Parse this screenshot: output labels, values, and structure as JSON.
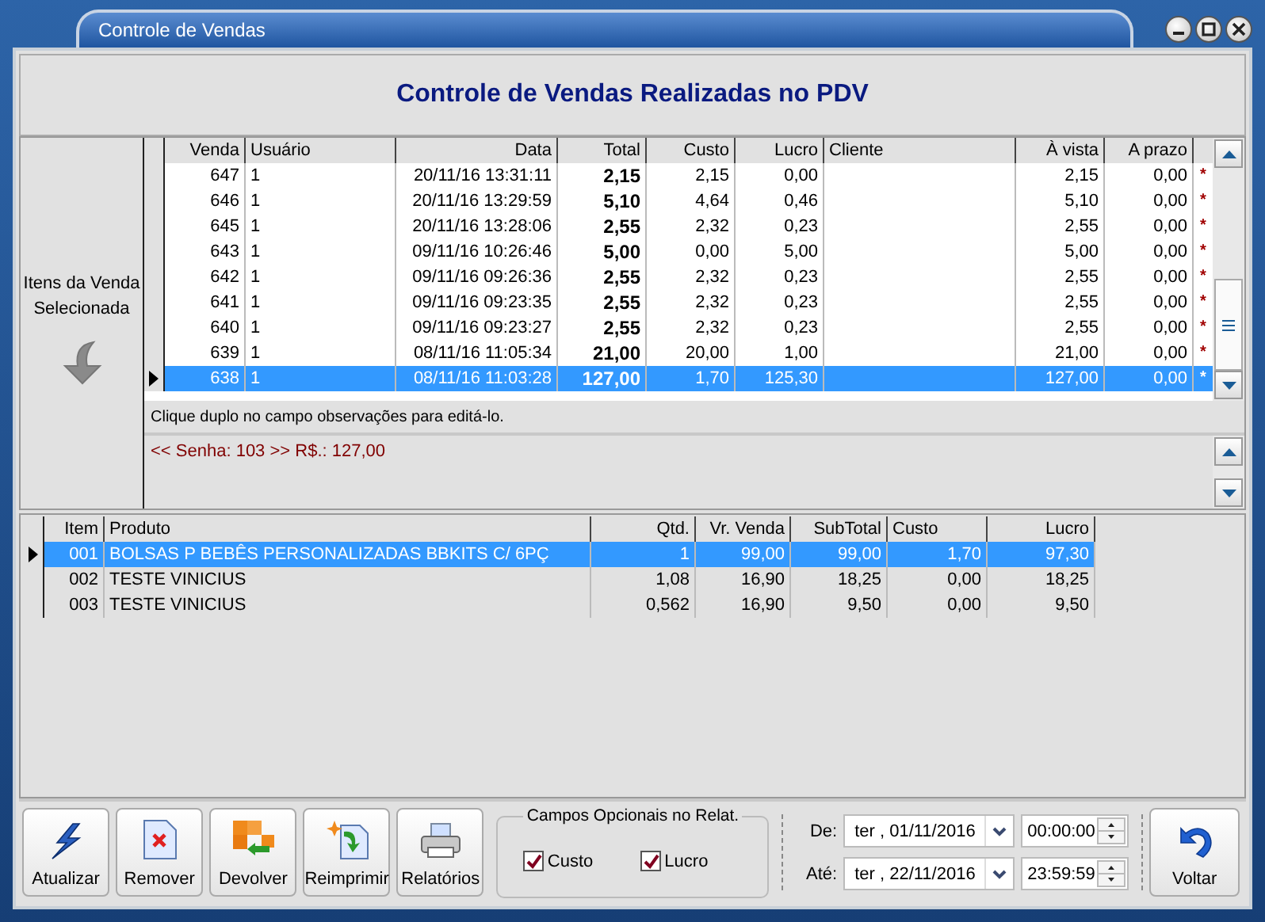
{
  "window": {
    "title": "Controle de Vendas",
    "controls": [
      {
        "kind": "minimize"
      },
      {
        "kind": "maximize"
      },
      {
        "kind": "close"
      }
    ]
  },
  "header": {
    "title": "Controle de Vendas Realizadas no PDV"
  },
  "side_panel": {
    "label": "Itens da Venda Selecionada"
  },
  "sales_table": {
    "columns": [
      "Venda",
      "Usuário",
      "Data",
      "Total",
      "Custo",
      "Lucro",
      "Cliente",
      "À vista",
      "A prazo"
    ],
    "rows": [
      {
        "cells": [
          "647",
          "1",
          "20/11/16 13:31:11",
          "2,15",
          "2,15",
          "0,00",
          "",
          "2,15",
          "0,00"
        ],
        "mark": "*",
        "selected": false
      },
      {
        "cells": [
          "646",
          "1",
          "20/11/16 13:29:59",
          "5,10",
          "4,64",
          "0,46",
          "",
          "5,10",
          "0,00"
        ],
        "mark": "*",
        "selected": false
      },
      {
        "cells": [
          "645",
          "1",
          "20/11/16 13:28:06",
          "2,55",
          "2,32",
          "0,23",
          "",
          "2,55",
          "0,00"
        ],
        "mark": "*",
        "selected": false
      },
      {
        "cells": [
          "643",
          "1",
          "09/11/16 10:26:46",
          "5,00",
          "0,00",
          "5,00",
          "",
          "5,00",
          "0,00"
        ],
        "mark": "*",
        "selected": false
      },
      {
        "cells": [
          "642",
          "1",
          "09/11/16 09:26:36",
          "2,55",
          "2,32",
          "0,23",
          "",
          "2,55",
          "0,00"
        ],
        "mark": "*",
        "selected": false
      },
      {
        "cells": [
          "641",
          "1",
          "09/11/16 09:23:35",
          "2,55",
          "2,32",
          "0,23",
          "",
          "2,55",
          "0,00"
        ],
        "mark": "*",
        "selected": false
      },
      {
        "cells": [
          "640",
          "1",
          "09/11/16 09:23:27",
          "2,55",
          "2,32",
          "0,23",
          "",
          "2,55",
          "0,00"
        ],
        "mark": "*",
        "selected": false
      },
      {
        "cells": [
          "639",
          "1",
          "08/11/16 11:05:34",
          "21,00",
          "20,00",
          "1,00",
          "",
          "21,00",
          "0,00"
        ],
        "mark": "*",
        "selected": false
      },
      {
        "cells": [
          "638",
          "1",
          "08/11/16 11:03:28",
          "127,00",
          "1,70",
          "125,30",
          "",
          "127,00",
          "0,00"
        ],
        "mark": "*",
        "selected": true
      }
    ],
    "hint": "Clique duplo no campo observações para editá-lo.",
    "note": "<< Senha: 103 >> R$.: 127,00"
  },
  "items_table": {
    "columns": [
      "Item",
      "Produto",
      "Qtd.",
      "Vr. Venda",
      "SubTotal",
      "Custo",
      "Lucro"
    ],
    "rows": [
      {
        "cells": [
          "001",
          "BOLSAS P BEBÊS PERSONALIZADAS BBKITS C/ 6PÇ",
          "1",
          "99,00",
          "99,00",
          "1,70",
          "97,30"
        ],
        "selected": true
      },
      {
        "cells": [
          "002",
          "TESTE VINICIUS",
          "1,08",
          "16,90",
          "18,25",
          "0,00",
          "18,25"
        ],
        "selected": false
      },
      {
        "cells": [
          "003",
          "TESTE VINICIUS",
          "0,562",
          "16,90",
          "9,50",
          "0,00",
          "9,50"
        ],
        "selected": false
      }
    ]
  },
  "toolbar": {
    "buttons": [
      {
        "kind": "refresh",
        "label": "Atualizar"
      },
      {
        "kind": "remove",
        "label": "Remover"
      },
      {
        "kind": "return",
        "label": "Devolver"
      },
      {
        "kind": "reprint",
        "label": "Reimprimir"
      },
      {
        "kind": "reports",
        "label": "Relatórios"
      }
    ],
    "optional_fields": {
      "title": "Campos Opcionais no Relat.",
      "options": [
        {
          "label": "Custo",
          "checked": true
        },
        {
          "label": "Lucro",
          "checked": true
        }
      ]
    },
    "range": [
      {
        "label": "De:",
        "date": "ter , 01/11/2016",
        "time": "00:00:00"
      },
      {
        "label": "Até:",
        "date": "ter , 22/11/2016",
        "time": "23:59:59"
      }
    ],
    "back_button": {
      "label": "Voltar"
    }
  }
}
